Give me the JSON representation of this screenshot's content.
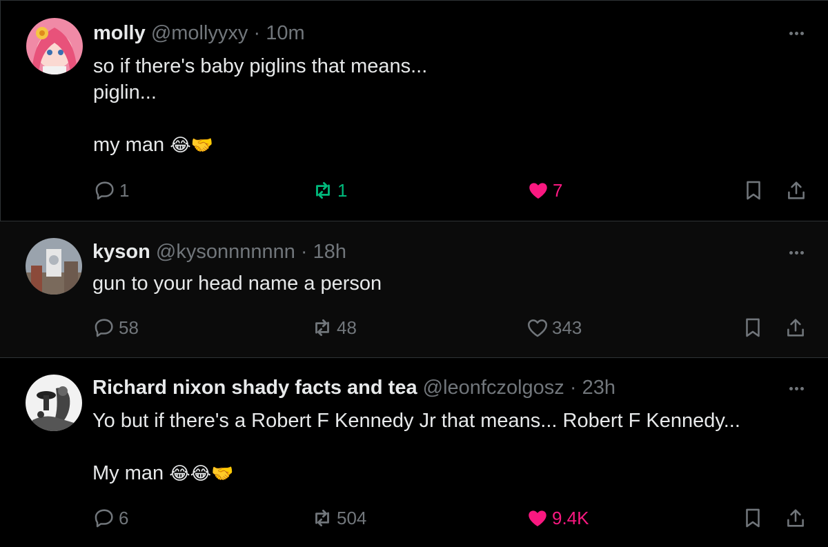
{
  "colors": {
    "background": "#000000",
    "text": "#e7e9ea",
    "muted": "#71767b",
    "repost_active": "#00ba7c",
    "like_active": "#f91880",
    "divider": "#2f3336"
  },
  "tweets": [
    {
      "name": "molly",
      "handle": "@mollyyxy",
      "separator": "·",
      "time": "10m",
      "text": "so if there's baby piglins that means...\npiglin...\n\nmy man",
      "emoji": "😂🤝",
      "replies": "1",
      "reposts": "1",
      "likes": "7",
      "reposted": true,
      "liked": true,
      "avatar_icon": "anime-avatar"
    },
    {
      "name": "kyson",
      "handle": "@kysonnnnnnn",
      "separator": "·",
      "time": "18h",
      "text": "gun to your head name a person",
      "emoji": "",
      "replies": "58",
      "reposts": "48",
      "likes": "343",
      "reposted": false,
      "liked": false,
      "avatar_icon": "building-photo-avatar"
    },
    {
      "name": "Richard nixon shady facts and tea",
      "handle": "@leonfczolgosz",
      "separator": "·",
      "time": "23h",
      "text": "Yo but if there's a Robert F Kennedy Jr that means... Robert F Kennedy...\n\nMy man",
      "emoji": "😂😂🤝",
      "replies": "6",
      "reposts": "504",
      "likes": "9.4K",
      "reposted": false,
      "liked": true,
      "avatar_icon": "engraving-avatar"
    }
  ]
}
